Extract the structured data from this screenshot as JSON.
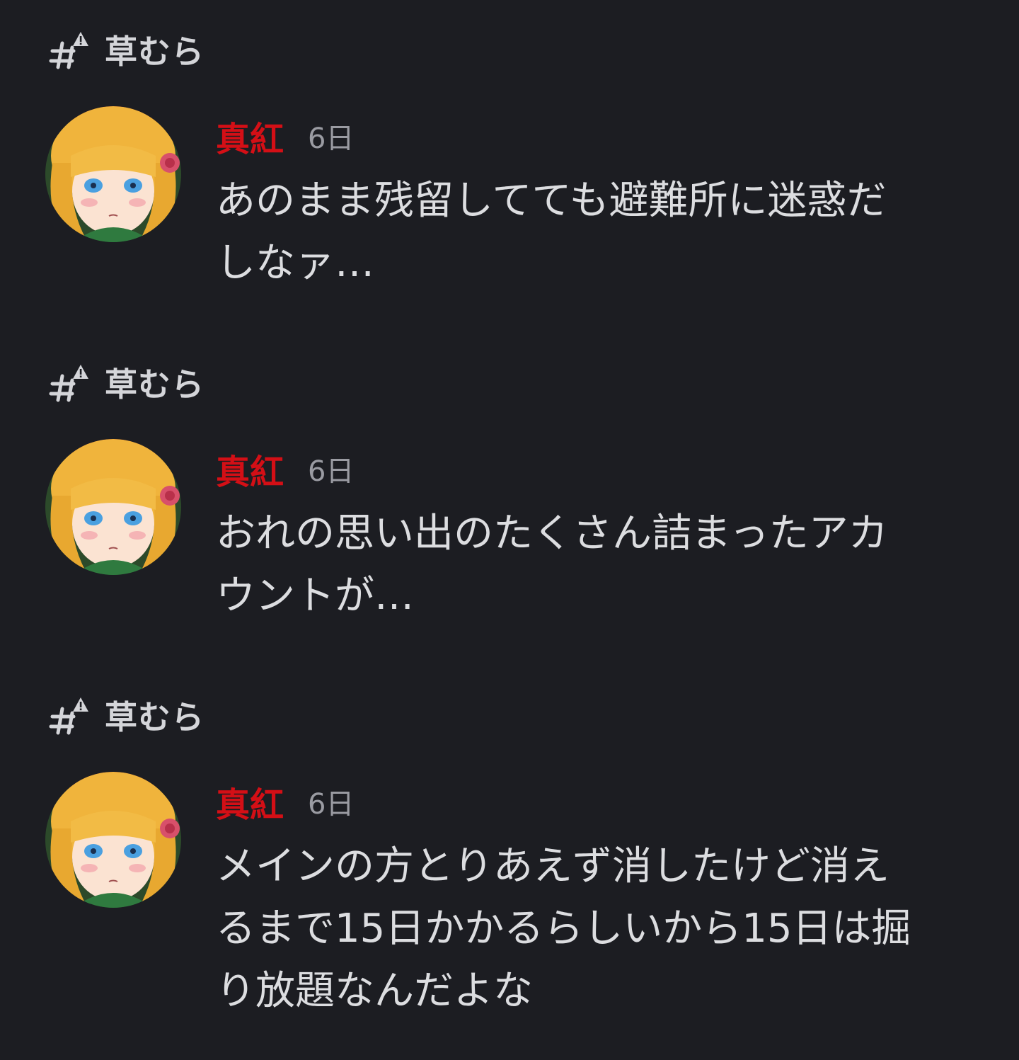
{
  "colors": {
    "background": "#1c1d22",
    "author_name": "#d40f16",
    "text": "#dcdde0",
    "muted": "#9a9ba2"
  },
  "results": [
    {
      "channel": {
        "icon": "channel-hash-warning-icon",
        "name": "草むら"
      },
      "message": {
        "author": "真紅",
        "timestamp": "6日",
        "avatar": "character-avatar",
        "text": "あのまま残留してても避難所に迷惑だしなァ…"
      }
    },
    {
      "channel": {
        "icon": "channel-hash-warning-icon",
        "name": "草むら"
      },
      "message": {
        "author": "真紅",
        "timestamp": "6日",
        "avatar": "character-avatar",
        "text": "おれの思い出のたくさん詰まったアカウントが…"
      }
    },
    {
      "channel": {
        "icon": "channel-hash-warning-icon",
        "name": "草むら"
      },
      "message": {
        "author": "真紅",
        "timestamp": "6日",
        "avatar": "character-avatar",
        "text": "メインの方とりあえず消したけど消えるまで15日かかるらしいから15日は掘り放題なんだよな"
      }
    }
  ]
}
